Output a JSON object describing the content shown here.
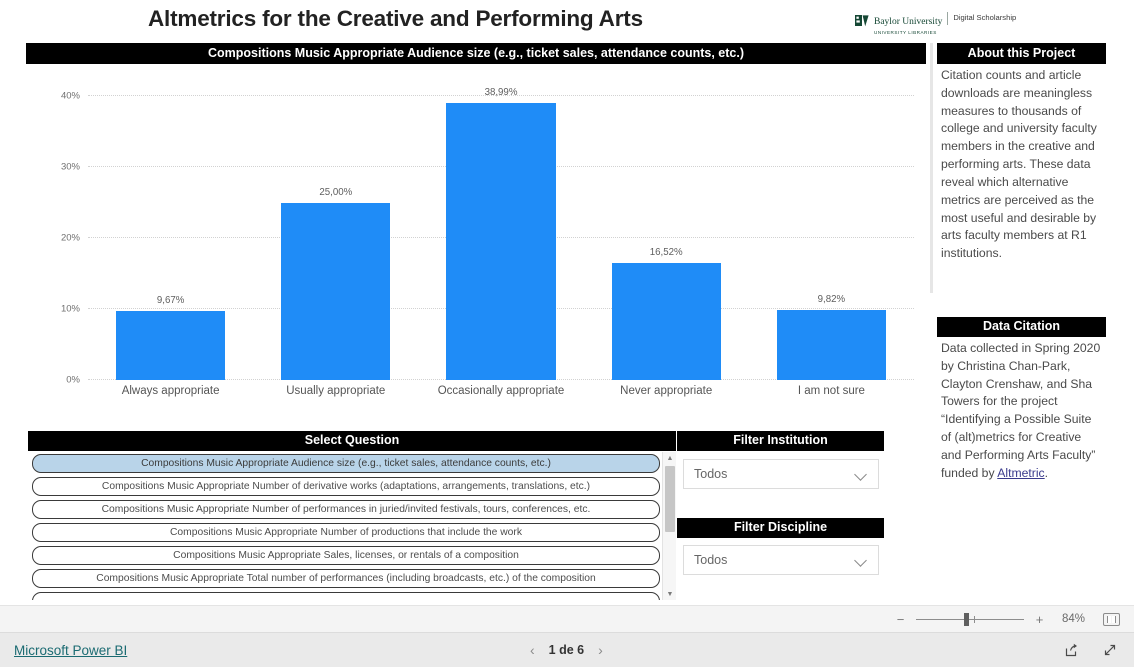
{
  "report": {
    "title": "Altmetrics for the Creative and Performing Arts",
    "brand": {
      "mark": "baylor-bear-logo",
      "name": "Baylor University",
      "sub": "UNIVERSITY LIBRARIES",
      "unit": "Digital Scholarship"
    }
  },
  "chart_panel": {
    "header": "Compositions Music Appropriate Audience size (e.g., ticket sales, attendance counts, etc.)"
  },
  "chart_data": {
    "type": "bar",
    "title": "Compositions Music Appropriate Audience size (e.g., ticket sales, attendance counts, etc.)",
    "categories": [
      "Always appropriate",
      "Usually appropriate",
      "Occasionally appropriate",
      "Never appropriate",
      "I am not sure"
    ],
    "values": [
      9.67,
      25.0,
      38.99,
      16.52,
      9.82
    ],
    "value_labels": [
      "9,67%",
      "25,00%",
      "38,99%",
      "16,52%",
      "9,82%"
    ],
    "ytick_labels": [
      "0%",
      "10%",
      "20%",
      "30%",
      "40%"
    ],
    "ytick_values": [
      0,
      10,
      20,
      30,
      40
    ],
    "ylim": [
      0,
      42
    ],
    "xlabel": "",
    "ylabel": "",
    "grid": true,
    "legend": "none",
    "bar_color": "#1f8cf7"
  },
  "about": {
    "header": "About this Project",
    "body": "Citation counts and article downloads are meaningless measures to thousands of college and university faculty members in the creative and performing arts.  These data reveal which alternative metrics are perceived as the most useful and desirable by arts faculty members at R1 institutions."
  },
  "citation": {
    "header": "Data Citation",
    "body_before_link": "Data collected in Spring 2020 by Christina Chan-Park, Clayton Crenshaw, and Sha Towers for the project “Identifying a Possible Suite of (alt)metrics for Creative and Performing Arts Faculty” funded by ",
    "link_text": "Altmetric",
    "body_after_link": "."
  },
  "question_slicer": {
    "header": "Select Question",
    "items": [
      {
        "label": "Compositions Music Appropriate Audience size (e.g., ticket sales, attendance counts, etc.)",
        "selected": true
      },
      {
        "label": "Compositions Music Appropriate Number of derivative works (adaptations, arrangements, translations, etc.)",
        "selected": false
      },
      {
        "label": "Compositions Music Appropriate Number of performances in juried/invited festivals, tours, conferences, etc.",
        "selected": false
      },
      {
        "label": "Compositions Music Appropriate Number of productions that include the work",
        "selected": false
      },
      {
        "label": "Compositions Music Appropriate Sales, licenses, or rentals of a composition",
        "selected": false
      },
      {
        "label": "Compositions Music Appropriate Total number of performances (including broadcasts, etc.) of the composition",
        "selected": false
      }
    ],
    "scroll_up_icon": "triangle-up-icon",
    "scroll_down_icon": "triangle-down-icon"
  },
  "institution_slicer": {
    "header": "Filter Institution",
    "value": "Todos",
    "chevron": "chevron-down-icon"
  },
  "discipline_slicer": {
    "header": "Filter Discipline",
    "value": "Todos",
    "chevron": "chevron-down-icon"
  },
  "zoom_bar": {
    "minus": "−",
    "plus": "+",
    "percent": "84%",
    "fit_icon": "fit-to-page-icon"
  },
  "footer": {
    "brand_link": "Microsoft Power BI",
    "prev_icon": "‹",
    "page_label": "1 de 6",
    "next_icon": "›",
    "share_icon": "share-icon",
    "fullscreen_icon": "fullscreen-icon"
  }
}
